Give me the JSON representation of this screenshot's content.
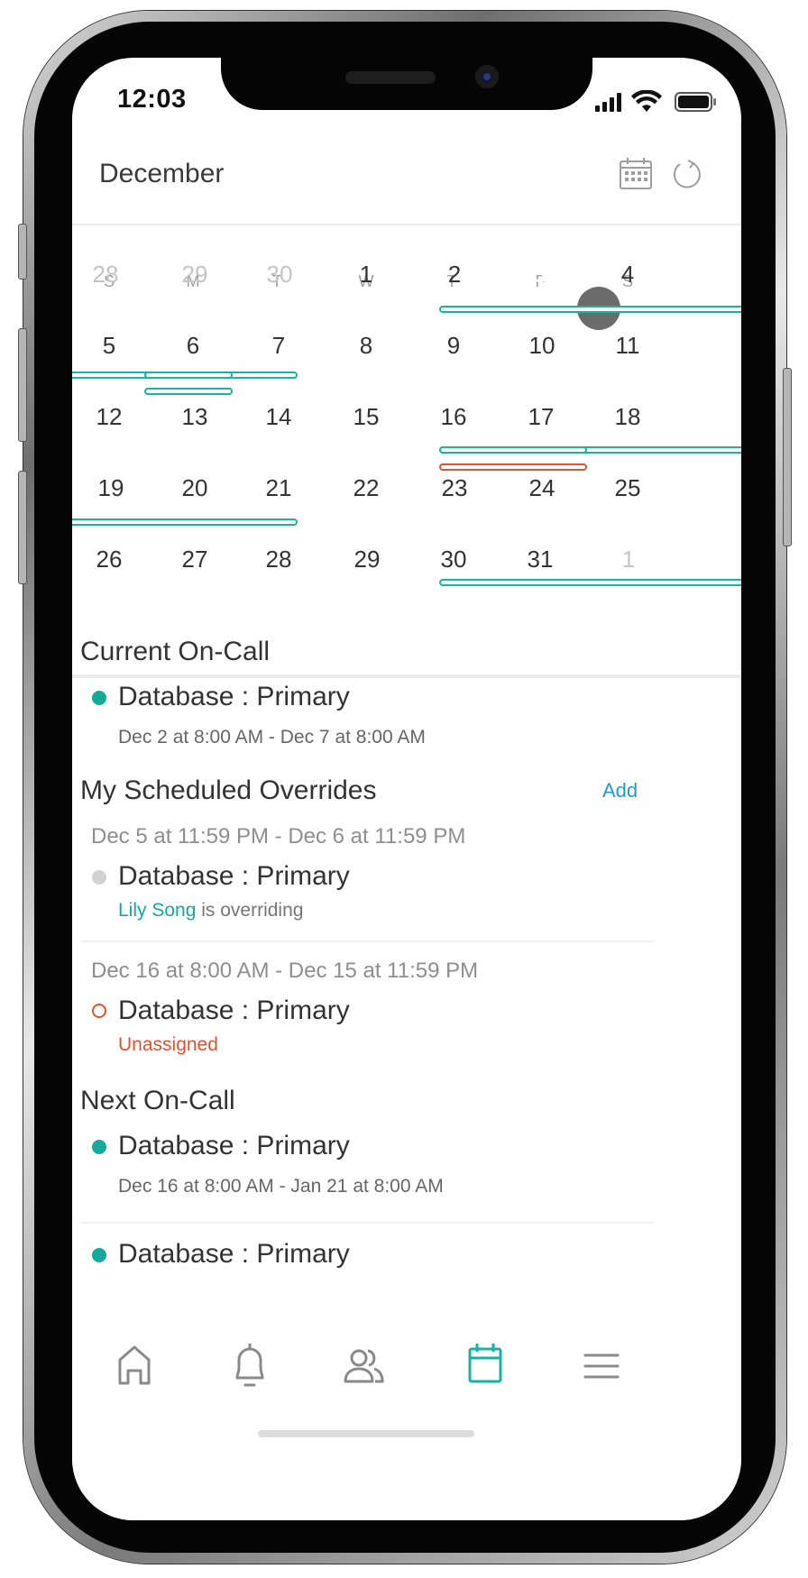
{
  "status_bar": {
    "time": "12:03"
  },
  "header": {
    "month": "December",
    "calendar_icon": "calendar-grid-icon",
    "refresh_icon": "refresh-icon"
  },
  "calendar": {
    "weekdays": [
      "S",
      "M",
      "T",
      "W",
      "T",
      "F",
      "S"
    ],
    "weeks": [
      [
        "28",
        "29",
        "30",
        "1",
        "2",
        "3",
        "4"
      ],
      [
        "5",
        "6",
        "7",
        "8",
        "9",
        "10",
        "11"
      ],
      [
        "12",
        "13",
        "14",
        "15",
        "16",
        "17",
        "18"
      ],
      [
        "19",
        "20",
        "21",
        "22",
        "23",
        "24",
        "25"
      ],
      [
        "26",
        "27",
        "28",
        "29",
        "30",
        "31",
        "1"
      ]
    ],
    "today": "3",
    "colors": {
      "on_call": "#19b3a4",
      "unassigned": "#e2522e",
      "today": "#6b6b6b"
    }
  },
  "current_oncall": {
    "title": "Current On-Call",
    "item": {
      "name": "Database : Primary",
      "range": "Dec 2 at 8:00 AM - Dec 7 at 8:00 AM"
    }
  },
  "overrides": {
    "title": "My Scheduled Overrides",
    "add_label": "Add",
    "items": [
      {
        "range": "Dec 5 at 11:59 PM - Dec 6 at 11:59 PM",
        "name": "Database : Primary",
        "user": "Lily Song",
        "suffix": " is overriding"
      },
      {
        "range": "Dec 16 at 8:00 AM - Dec 15 at 11:59 PM",
        "name": "Database : Primary",
        "status": "Unassigned"
      }
    ]
  },
  "next_oncall": {
    "title": "Next On-Call",
    "items": [
      {
        "name": "Database : Primary",
        "range": "Dec 16 at 8:00 AM - Jan 21 at 8:00 AM"
      },
      {
        "name": "Database : Primary"
      }
    ]
  },
  "tabbar": {
    "tabs": [
      "home-icon",
      "bell-icon",
      "users-icon",
      "calendar-icon",
      "menu-icon"
    ],
    "active": "calendar-icon",
    "active_color": "#19b3a4",
    "inactive_color": "#8a8a8a"
  }
}
